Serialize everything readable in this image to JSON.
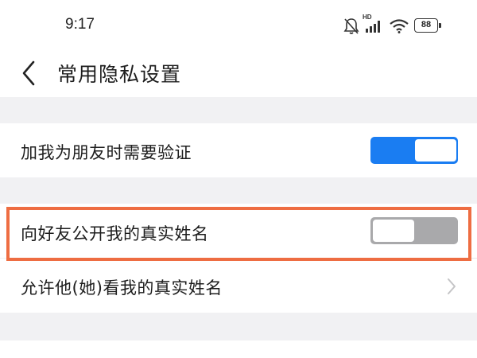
{
  "status_bar": {
    "time": "9:17",
    "icons": [
      "bell-off-icon",
      "hd-signal-icon",
      "wifi-icon",
      "battery-icon"
    ],
    "network_badge": "HD",
    "battery_level": "88"
  },
  "header": {
    "back_icon": "chevron-left-icon",
    "title": "常用隐私设置"
  },
  "settings": [
    {
      "label": "加我为朋友时需要验证",
      "control": "toggle",
      "on": true
    },
    {
      "label": "向好友公开我的真实姓名",
      "control": "toggle",
      "on": false,
      "highlighted": true
    },
    {
      "label": "允许他(她)看我的真实姓名",
      "control": "chevron-right-icon"
    }
  ],
  "colors": {
    "accent": "#1a7df2",
    "highlight": "#ee6d42",
    "toggle_off": "#a9a9ab",
    "background": "#f1f1f3"
  }
}
